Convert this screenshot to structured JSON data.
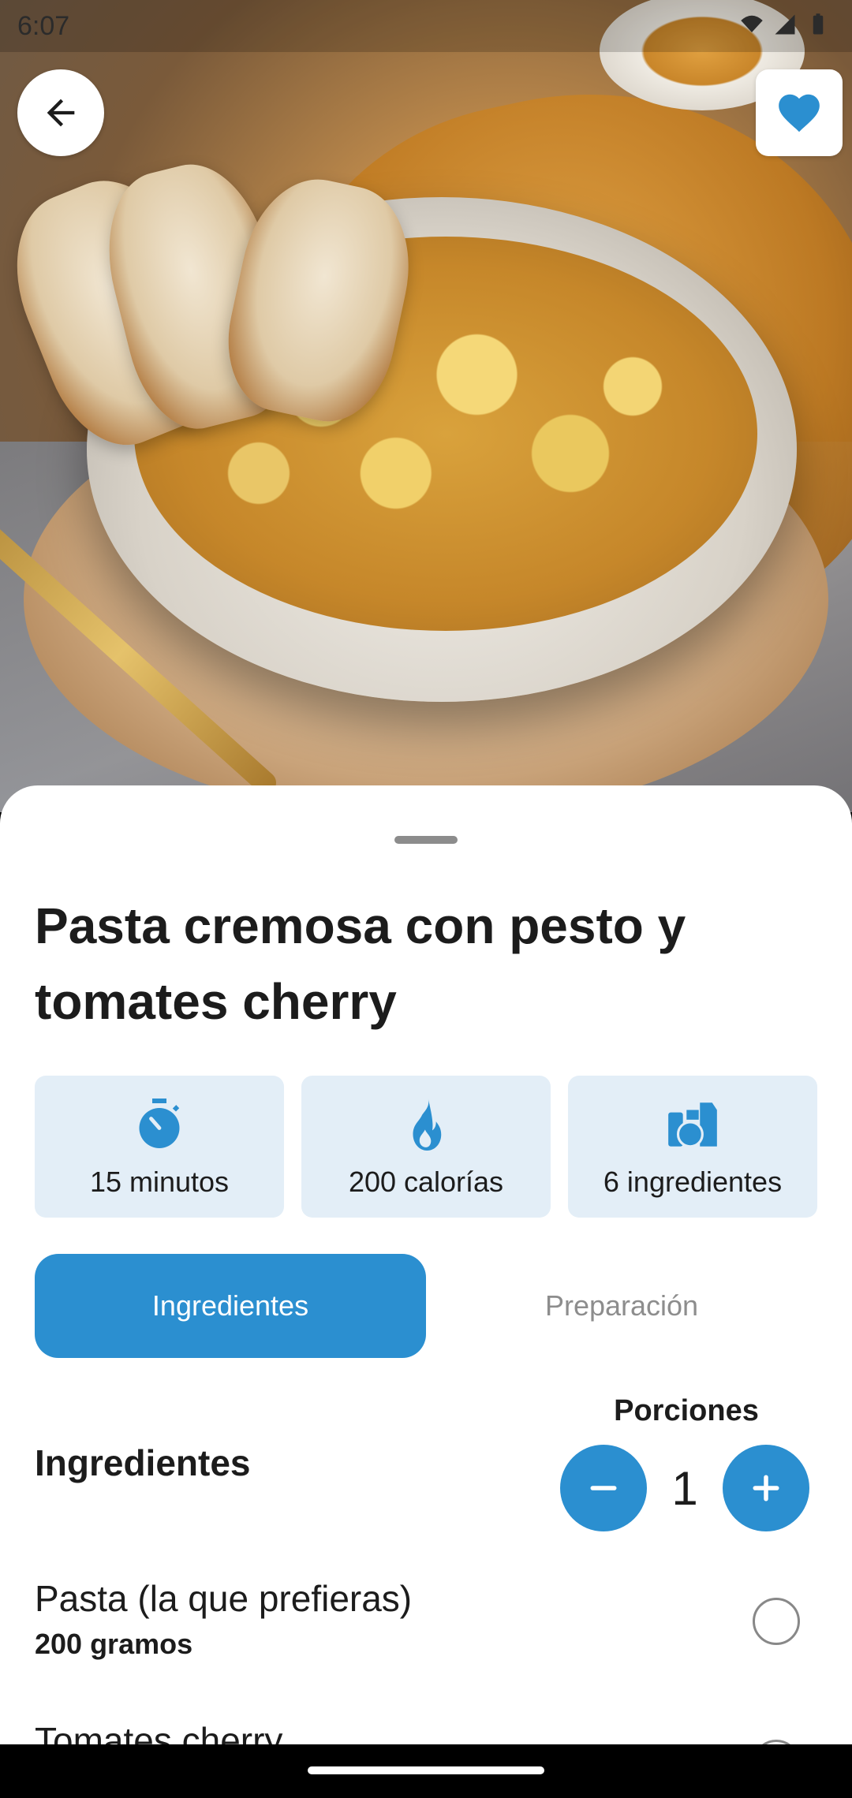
{
  "status_bar": {
    "time": "6:07"
  },
  "colors": {
    "accent": "#2b8fd0",
    "card_bg": "#e3eef7"
  },
  "recipe": {
    "title": "Pasta cremosa con pesto y tomates cherry",
    "stats": [
      {
        "icon": "stopwatch-icon",
        "label": "15 minutos"
      },
      {
        "icon": "flame-icon",
        "label": "200 calorías"
      },
      {
        "icon": "ingredients-icon",
        "label": "6 ingredientes"
      }
    ]
  },
  "tabs": [
    {
      "label": "Ingredientes",
      "active": true
    },
    {
      "label": "Preparación",
      "active": false
    }
  ],
  "ingredients_section": {
    "title": "Ingredientes",
    "portions_label": "Porciones",
    "portions_value": "1",
    "items": [
      {
        "name": "Pasta (la que prefieras)",
        "amount": "200 gramos"
      },
      {
        "name": "Tomates cherry",
        "amount": ""
      }
    ]
  }
}
